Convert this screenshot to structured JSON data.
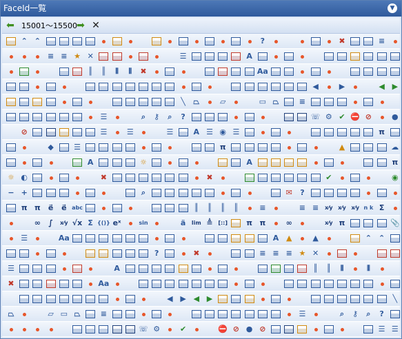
{
  "title": "FaceId一覧",
  "nav": {
    "range": "15001～15500"
  },
  "icons": [
    "doc-pencil",
    "chevron-up",
    "chevron-up",
    "speech-balloon",
    "calculator",
    "traffic-light",
    "table",
    "folder",
    "folder-open",
    "chart",
    "database",
    "globe",
    "help",
    "user-card",
    "close-red",
    "wand",
    "spreadsheet",
    "lines",
    "lines",
    "lines",
    "star",
    "close-black",
    "document-red",
    "document-red",
    "stopwatch",
    "list",
    "chart-bar",
    "table",
    "image",
    "folder-red",
    "font-a",
    "white-window",
    "cursor-a",
    "frame",
    "chart",
    "pencil-table",
    "ruler",
    "draw-table",
    "crop",
    "table-green",
    "chart-line",
    "note",
    "barcode",
    "barcode",
    "columns",
    "columns",
    "close-red",
    "doc-edit",
    "doc-edit",
    "chart-red",
    "page",
    "bold-a",
    "abc-aa",
    "image",
    "table",
    "table",
    "table",
    "frame",
    "books",
    "floppy",
    "grid",
    "grid",
    "table",
    "table",
    "document",
    "table",
    "table",
    "table",
    "table",
    "table",
    "table",
    "table",
    "table",
    "table",
    "table",
    "table",
    "table",
    "arrow-left",
    "arrow-right",
    "back-green",
    "forward-green",
    "doc-pencil",
    "doc-pen",
    "star-page",
    "table",
    "table",
    "table",
    "table",
    "table",
    "table",
    "table",
    "line",
    "trapezoid",
    "parallelogram",
    "rectangle",
    "trapezoid",
    "doc-edit",
    "lines",
    "text-box",
    "image",
    "layers",
    "text-box",
    "chart",
    "image",
    "org-chart",
    "font-color",
    "chart-blue",
    "doc-chart",
    "list",
    "magnifier",
    "key",
    "search",
    "help",
    "text-format",
    "text-format",
    "text-format",
    "text-format",
    "picture",
    "picture",
    "phone",
    "gear",
    "check",
    "stop",
    "no",
    "record",
    "no",
    "doc",
    "picture",
    "folder",
    "view",
    "abc-box",
    "list",
    "list",
    "list",
    "image",
    "font-a",
    "list",
    "radio",
    "list",
    "abl-box",
    "doc",
    "page",
    "page",
    "page",
    "page",
    "page",
    "pi",
    "table",
    "table",
    "palette",
    "image",
    "list",
    "page",
    "table",
    "table",
    "page",
    "page",
    "page",
    "page",
    "pi",
    "table",
    "table",
    "connector",
    "connector",
    "connector",
    "person",
    "page-arrow",
    "view",
    "cursor",
    "cloud",
    "id-card",
    "doc",
    "abc-check",
    "font-a",
    "chart",
    "frame",
    "frame",
    "sun",
    "pages",
    "doc",
    "pencil",
    "shapes",
    "font-a",
    "pencil",
    "pencil",
    "pencil",
    "pencil",
    "image",
    "page",
    "table",
    "pi",
    "sun",
    "contrast",
    "layers",
    "page",
    "close-red",
    "page",
    "page",
    "page",
    "page",
    "doc",
    "cursor",
    "close-red",
    "checklist",
    "page",
    "page",
    "table",
    "doc",
    "doc",
    "check",
    "cursor",
    "nav-green",
    "minus",
    "plus",
    "text-format",
    "crop",
    "crop",
    "form",
    "doc",
    "search",
    "doc",
    "page",
    "page",
    "page",
    "page",
    "doc-chart",
    "page",
    "envelope-red",
    "help",
    "shield",
    "page",
    "doc",
    "paint",
    "table",
    "table",
    "pi",
    "pi",
    "equation",
    "equation",
    "abc-small",
    "table",
    "table",
    "table",
    "table",
    "table",
    "bar-code",
    "bar-code",
    "bar-code",
    "bar-code",
    "lines",
    "lines",
    "lines",
    "fraction",
    "fraction",
    "fraction",
    "n-over-k",
    "sigma-table",
    "infinity",
    "integral",
    "fraction",
    "radical",
    "sum-sub",
    "brace",
    "exp",
    "sin-theta",
    "diaeresis",
    "limit",
    "delta",
    "matrix",
    "pencil",
    "pi",
    "pi",
    "infinity",
    "fraction",
    "pi",
    "doc",
    "page",
    "font-color",
    "paperclip",
    "list",
    "abc-aa",
    "dice",
    "page",
    "doc",
    "page",
    "page",
    "page",
    "page",
    "page",
    "page",
    "folder",
    "folder",
    "chart",
    "font-a",
    "person",
    "triangle"
  ]
}
